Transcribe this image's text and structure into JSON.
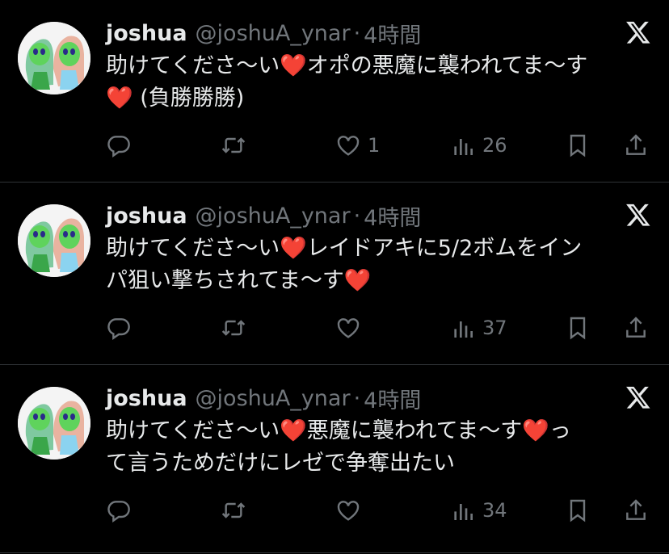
{
  "tweets": [
    {
      "name": "joshua",
      "handle": "@joshuA_ynar",
      "separator": "·",
      "time": "4時間",
      "text": "助けてくださ〜い❤️オポの悪魔に襲われてま〜す\n❤️ (負勝勝勝)",
      "like_count": "1",
      "view_count": "26"
    },
    {
      "name": "joshua",
      "handle": "@joshuA_ynar",
      "separator": "·",
      "time": "4時間",
      "text": "助けてくださ〜い❤️レイドアキに5/2ボムをイン\nパ狙い撃ちされてま〜す❤️",
      "like_count": "",
      "view_count": "37"
    },
    {
      "name": "joshua",
      "handle": "@joshuA_ynar",
      "separator": "·",
      "time": "4時間",
      "text": "助けてくださ〜い❤️悪魔に襲われてま〜す❤️っ\nて言うためだけにレゼで争奪出たい",
      "like_count": "",
      "view_count": "34"
    }
  ],
  "icons": {
    "reply": "reply-icon",
    "retweet": "retweet-icon",
    "like": "heart-icon",
    "views": "views-icon",
    "bookmark": "bookmark-icon",
    "share": "share-icon",
    "platform": "x-logo-icon"
  },
  "colors": {
    "background": "#000000",
    "text": "#e7e9ea",
    "muted": "#71767b",
    "divider": "#2f3336"
  }
}
